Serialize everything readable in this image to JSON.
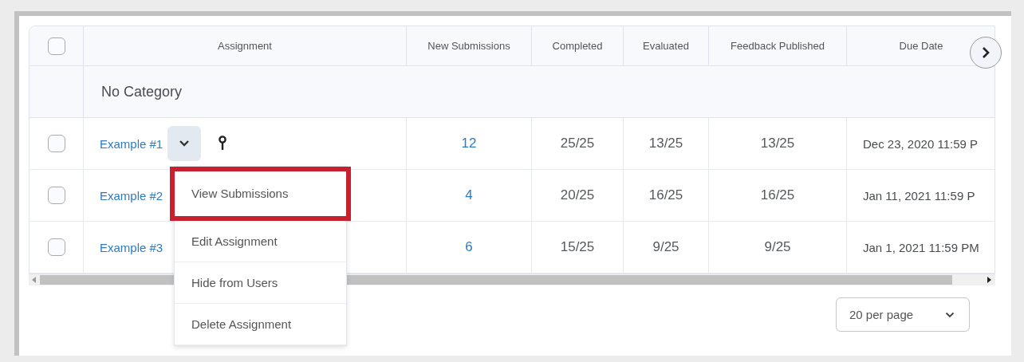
{
  "table": {
    "select_all": {
      "checked": false
    },
    "columns": [
      "Assignment",
      "New Submissions",
      "Completed",
      "Evaluated",
      "Feedback Published",
      "Due Date"
    ],
    "category": "No Category",
    "rows": [
      {
        "checked": false,
        "name": "Example #1",
        "expanded": true,
        "new_submissions": "12",
        "completed": "25/25",
        "evaluated": "13/25",
        "feedback_published": "13/25",
        "due_date": "Dec 23, 2020 11:59 P"
      },
      {
        "checked": false,
        "name": "Example #2",
        "expanded": false,
        "new_submissions": "4",
        "completed": "20/25",
        "evaluated": "16/25",
        "feedback_published": "16/25",
        "due_date": "Jan 11, 2021 11:59 P"
      },
      {
        "checked": false,
        "name": "Example #3",
        "expanded": false,
        "new_submissions": "6",
        "completed": "15/25",
        "evaluated": "9/25",
        "feedback_published": "9/25",
        "due_date": "Jan 1, 2021 11:59 PM"
      }
    ]
  },
  "context_menu": {
    "items": [
      {
        "label": "View Submissions",
        "highlighted": true
      },
      {
        "label": "Edit Assignment",
        "highlighted": false
      },
      {
        "label": "Hide from Users",
        "highlighted": false
      },
      {
        "label": "Delete Assignment",
        "highlighted": false
      }
    ]
  },
  "page_size": "20 per page"
}
